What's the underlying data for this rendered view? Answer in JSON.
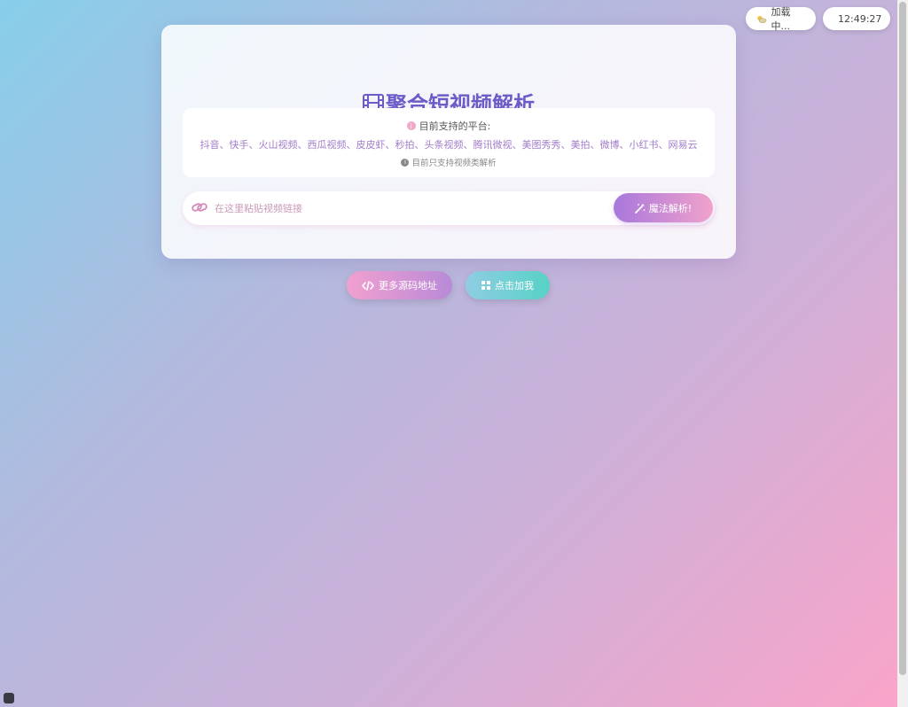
{
  "header": {
    "weather_text": "加载中...",
    "clock_text": "12:49:27"
  },
  "main": {
    "title": "聚合短视频解析",
    "platform_heading": "目前支持的平台:",
    "platform_list": "抖音、快手、火山视频、西瓜视频、皮皮虾、秒拍、头条视频、腾讯微视、美图秀秀、美拍、微博、小红书、网易云",
    "platform_note": "目前只支持视频类解析",
    "search": {
      "placeholder": "在这里粘贴视频链接",
      "value": ""
    },
    "parse_label": "魔法解析!"
  },
  "actions": {
    "source_label": "更多源码地址",
    "click_label": "点击加我"
  },
  "icons": {
    "weather": "weather-sun-cloud-icon",
    "clock": "clock-icon",
    "title": "film-icon",
    "info": "info-icon",
    "link": "link-icon",
    "magic": "magic-wand-icon",
    "code": "code-icon",
    "grid": "grid-icon"
  },
  "colors": {
    "title": "#6c5bc8",
    "platform_text": "#a17dc9",
    "parse_button": "#a877dc",
    "source_button": "#f1a0cf",
    "click_button": "#57d2c5"
  }
}
